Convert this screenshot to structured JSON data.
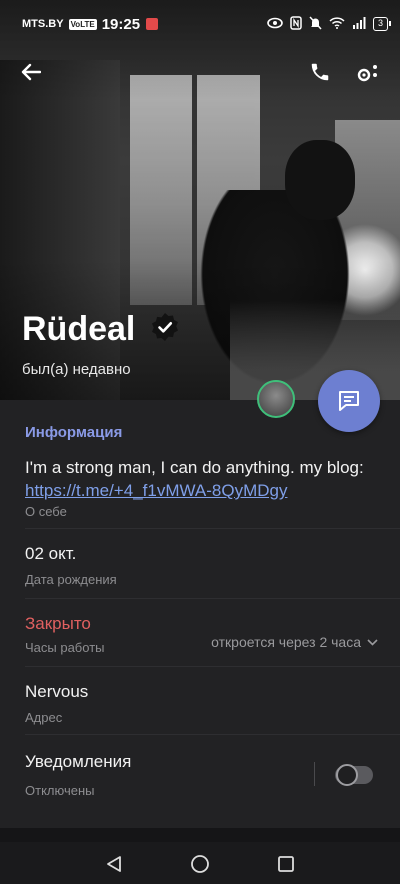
{
  "status_bar": {
    "carrier": "MTS.BY",
    "volte": "VoLTE",
    "time": "19:25",
    "battery": "3"
  },
  "profile": {
    "name": "Rüdeal",
    "last_seen": "был(а) недавно"
  },
  "info": {
    "section_title": "Информация",
    "bio_text": "I'm a strong man, I can do anything. my blog: ",
    "bio_link": "https://t.me/+4_f1vMWA-8QyMDgy",
    "bio_label": "О себе",
    "birthday_value": "02 окт.",
    "birthday_label": "Дата рождения",
    "hours_value": "Закрыто",
    "hours_label": "Часы работы",
    "hours_opens": "откроется через 2 часа",
    "address_value": "Nervous",
    "address_label": "Адрес",
    "notifications_value": "Уведомления",
    "notifications_label": "Отключены",
    "notifications_enabled": false
  },
  "colors": {
    "accent": "#8a9ae6",
    "fab": "#6d7fd1",
    "closed": "#e06060",
    "link": "#7f9fe8"
  }
}
